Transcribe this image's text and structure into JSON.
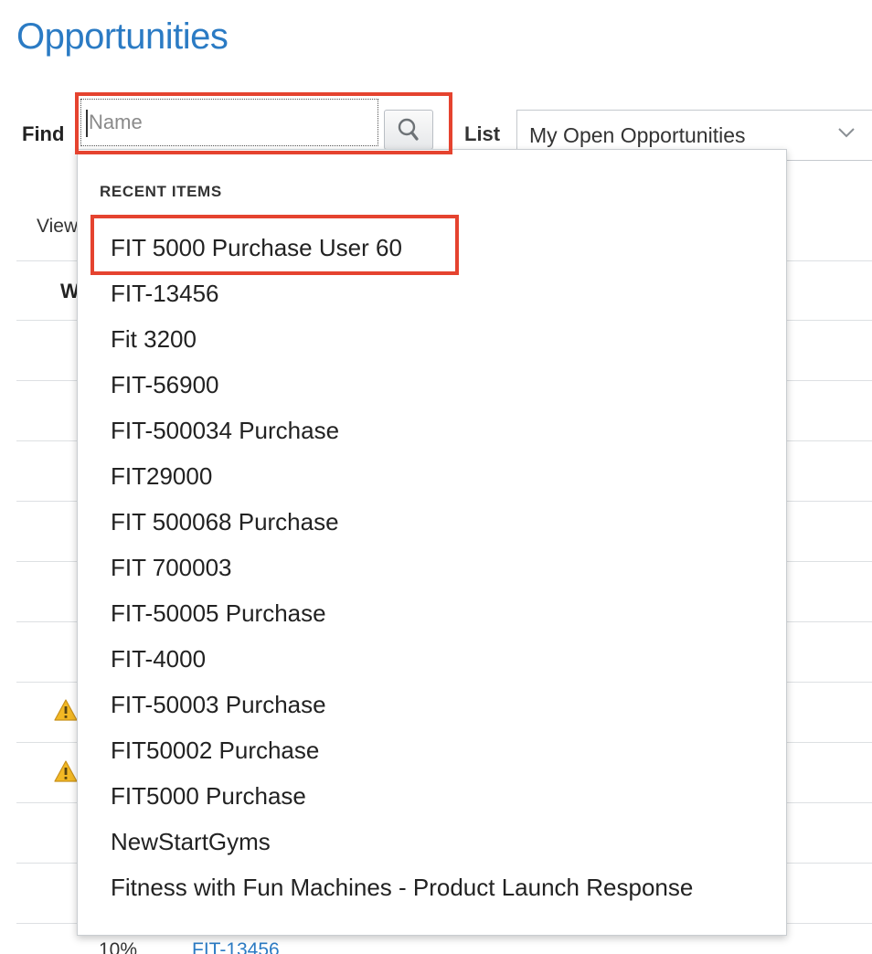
{
  "page": {
    "title": "Opportunities"
  },
  "find": {
    "label": "Find",
    "placeholder": "Name"
  },
  "list": {
    "label": "List",
    "selected": "My Open Opportunities"
  },
  "background": {
    "view_label": "View",
    "column_label": "W",
    "bottom_row": {
      "percent": "10%",
      "link": "FIT-13456"
    }
  },
  "recent": {
    "heading": "RECENT ITEMS",
    "items": [
      "FIT 5000 Purchase User 60",
      "FIT-13456",
      "Fit 3200",
      "FIT-56900",
      "FIT-500034 Purchase",
      "FIT29000",
      "FIT 500068 Purchase",
      "FIT 700003",
      "FIT-50005 Purchase",
      "FIT-4000",
      "FIT-50003 Purchase",
      "FIT50002 Purchase",
      "FIT5000 Purchase",
      "NewStartGyms",
      "Fitness with Fun Machines - Product Launch Response"
    ]
  },
  "colors": {
    "title": "#2b7bc4",
    "highlight": "#e5432f",
    "warning": "#f2b824",
    "link": "#2b7bc4"
  },
  "icons": {
    "search": "search-icon",
    "dropdown": "chevron-down-icon",
    "warning": "warning-icon"
  }
}
